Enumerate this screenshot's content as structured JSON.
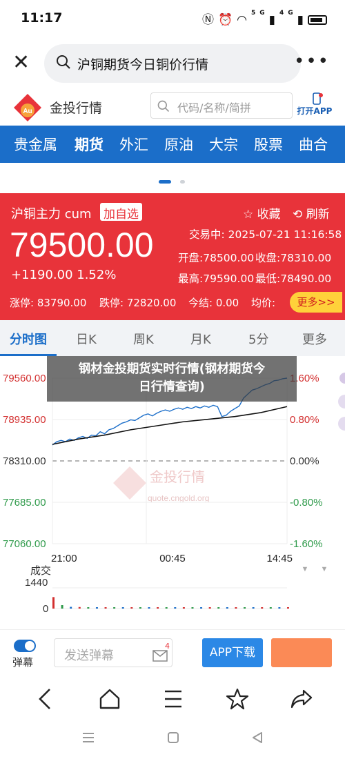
{
  "status_bar": {
    "time": "11:17",
    "signal1": "5G",
    "signal2": "4G"
  },
  "search": {
    "query": "沪铜期货今日铜价行情"
  },
  "brand": {
    "name": "金投行情",
    "code_placeholder": "代码/名称/简拼",
    "open_app": "打开APP"
  },
  "categories": [
    {
      "label": "贵金属",
      "active": false
    },
    {
      "label": "期货",
      "active": true
    },
    {
      "label": "外汇",
      "active": false
    },
    {
      "label": "原油",
      "active": false
    },
    {
      "label": "大宗",
      "active": false
    },
    {
      "label": "股票",
      "active": false
    },
    {
      "label": "曲合",
      "active": false
    }
  ],
  "quote": {
    "name": "沪铜主力 cum",
    "add_watch": "加自选",
    "fav": "☆ 收藏",
    "refresh": "刷新",
    "price": "79500.00",
    "change": "+1190.00 1.52%",
    "trade_time": "交易中: 2025-07-21 11:16:58",
    "open": "开盘:78500.00",
    "prev_close": "收盘:78310.00",
    "high": "最高:79590.00",
    "low": "最低:78490.00",
    "limit_up": "涨停: 83790.00",
    "limit_down": "跌停: 72820.00",
    "settle": "今结: 0.00",
    "avg": "均价:",
    "more": "更多>>"
  },
  "tabs": [
    {
      "label": "分时图",
      "active": true
    },
    {
      "label": "日K",
      "active": false
    },
    {
      "label": "周K",
      "active": false
    },
    {
      "label": "月K",
      "active": false
    },
    {
      "label": "5分",
      "active": false
    },
    {
      "label": "更多",
      "active": false
    }
  ],
  "overlay": {
    "line1": "钢材金投期货实时行情(钢材期货今",
    "line2": "日行情查询)"
  },
  "chart_data": {
    "type": "line",
    "y_left_ticks": [
      "79560.00",
      "78935.00",
      "78310.00",
      "77685.00",
      "77060.00"
    ],
    "y_right_ticks": [
      "1.60%",
      "0.80%",
      "0.00%",
      "-0.80%",
      "-1.60%"
    ],
    "x_ticks": [
      "21:00",
      "00:45",
      "14:45"
    ],
    "ylim": [
      77060,
      79560
    ],
    "baseline": 78310,
    "series": [
      {
        "color": "#1b6ec9",
        "x": [
          0,
          5,
          10,
          15,
          20,
          25,
          30,
          35,
          40,
          45,
          50,
          55,
          60,
          65,
          70,
          75,
          80,
          85,
          90,
          95,
          100,
          105,
          110,
          115,
          120,
          125,
          130,
          135,
          140,
          145,
          150,
          155,
          160,
          165,
          170,
          175,
          180,
          185,
          190,
          195,
          200,
          205,
          210,
          215,
          220,
          225,
          230,
          235,
          240,
          245,
          250,
          255,
          260,
          265,
          270
        ],
        "values": [
          78550,
          78600,
          78620,
          78600,
          78640,
          78620,
          78660,
          78680,
          78650,
          78700,
          78690,
          78750,
          78720,
          78780,
          78800,
          78840,
          78880,
          78900,
          78930,
          78920,
          78960,
          79000,
          79020,
          78990,
          79030,
          79060,
          79080,
          79060,
          79090,
          79110,
          79090,
          79120,
          79100,
          79130,
          79110,
          79140,
          79120,
          79150,
          79130,
          78980,
          79000,
          79060,
          79100,
          79140,
          79260,
          79320,
          79380,
          79400,
          79430,
          79460,
          79480,
          79520,
          79530,
          79550,
          79560
        ]
      },
      {
        "color": "#111111",
        "x": [
          0,
          30,
          60,
          90,
          120,
          150,
          180,
          210,
          240,
          270
        ],
        "values": [
          78560,
          78640,
          78700,
          78780,
          78840,
          78900,
          78940,
          78980,
          79040,
          79130
        ]
      }
    ],
    "volume": {
      "label": "成交",
      "max_label": "1440",
      "zero_label": "0",
      "x": [
        0,
        10,
        20,
        30,
        40,
        50,
        60,
        70,
        80,
        90,
        100,
        110,
        120,
        130,
        140,
        150,
        160,
        170,
        180,
        190,
        200,
        210,
        220,
        230,
        240,
        250,
        260,
        270
      ],
      "values": [
        600,
        180,
        90,
        80,
        70,
        60,
        55,
        50,
        45,
        48,
        42,
        40,
        38,
        40,
        36,
        35,
        34,
        33,
        32,
        30,
        31,
        30,
        28,
        30,
        29,
        28,
        27,
        26
      ]
    },
    "watermark": "金投行情",
    "watermark_url": "quote.cngold.org"
  },
  "bottom_bar": {
    "barrage": "弹幕",
    "send_placeholder": "发送弹幕",
    "badge": "4",
    "app_download": "APP下载"
  },
  "colors": {
    "brand_blue": "#1b6ec9",
    "quote_red": "#e8333a",
    "up_red": "#d32f2f",
    "down_green": "#2e9a4a",
    "yellow": "#ffd13a",
    "orange": "#fb8a56"
  }
}
